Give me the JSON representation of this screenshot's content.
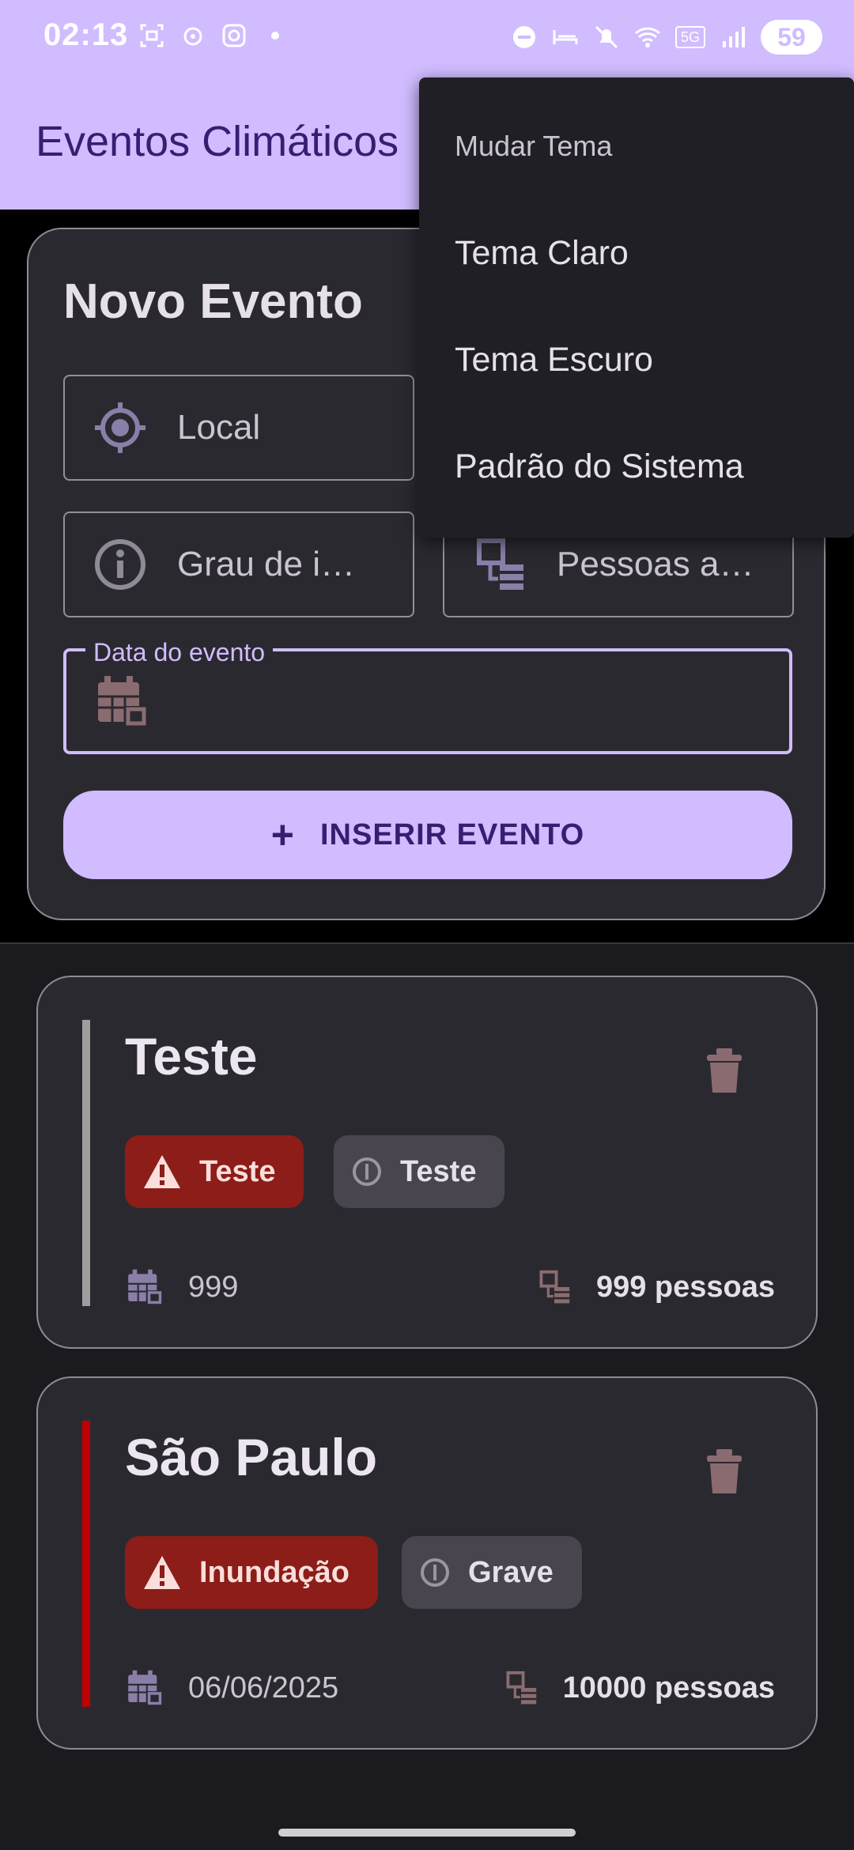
{
  "status_bar": {
    "time": "02:13",
    "battery": "59",
    "left_icons": [
      "screenshot-icon",
      "location-icon",
      "instagram-icon",
      "dot-icon"
    ],
    "right_icons": [
      "dnd-icon",
      "sleep-icon",
      "mute-icon",
      "wifi-icon",
      "5g-icon",
      "signal-icon",
      "battery-icon"
    ]
  },
  "app_bar": {
    "title": "Eventos Climáticos"
  },
  "form": {
    "title": "Novo Evento",
    "fields": {
      "local_placeholder": "Local",
      "grau_placeholder": "Grau de i…",
      "pessoas_placeholder": "Pessoas a…",
      "data_label": "Data do evento",
      "data_value": ""
    },
    "insert_button": "INSERIR EVENTO"
  },
  "menu": {
    "header": "Mudar Tema",
    "items": [
      "Tema Claro",
      "Tema Escuro",
      "Padrão do Sistema"
    ]
  },
  "events": [
    {
      "title": "Teste",
      "type": "Teste",
      "severity": "Teste",
      "date": "999",
      "people": "999 pessoas",
      "accent_color": "#9e9e9e"
    },
    {
      "title": "São Paulo",
      "type": "Inundação",
      "severity": "Grave",
      "date": "06/06/2025",
      "people": "10000 pessoas",
      "accent_color": "#c00000"
    }
  ],
  "colors": {
    "primary": "#d0bcff",
    "on_primary": "#381e72",
    "surface": "#2b2930",
    "error_container": "#8c1d18",
    "icon_muted": "#8a7fa8",
    "trash": "#8a6c70"
  }
}
